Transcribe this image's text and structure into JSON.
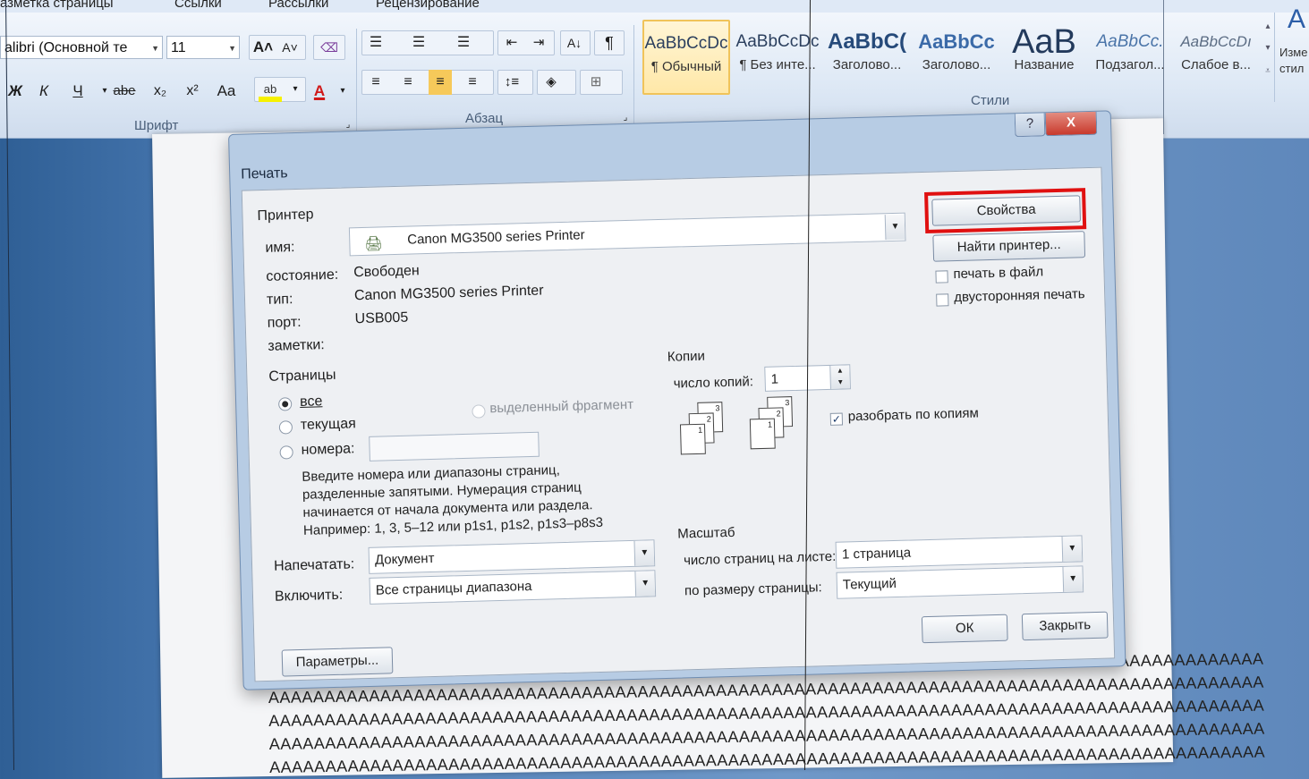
{
  "ribbon": {
    "tabs": [
      "азметка страницы",
      "Ссылки",
      "Рассылки",
      "Рецензирование"
    ],
    "font_name": "alibri (Основной те",
    "font_size": "11",
    "groups": {
      "font": "Шрифт",
      "paragraph": "Абзац",
      "styles": "Стили"
    },
    "styles": [
      {
        "sample": "AaBbCcDc",
        "name": "¶ Обычный"
      },
      {
        "sample": "AaBbCcDc",
        "name": "¶ Без инте..."
      },
      {
        "sample": "AaBbC(",
        "name": "Заголово..."
      },
      {
        "sample": "AaBbCc",
        "name": "Заголово..."
      },
      {
        "sample": "AaB",
        "name": "Название"
      },
      {
        "sample": "AaBbCc.",
        "name": "Подзагол..."
      },
      {
        "sample": "AaBbCcDı",
        "name": "Слабое в..."
      }
    ],
    "change_styles": "Изме стил",
    "format_buttons": {
      "bold": "Ж",
      "italic": "К",
      "underline": "Ч",
      "strike": "abe",
      "sub": "x₂",
      "sup": "x²",
      "case": "Aa",
      "grow": "A˄",
      "shrink": "A˅"
    }
  },
  "dialog": {
    "title": "Печать",
    "help_button": "?",
    "close_button": "X",
    "printer_section": "Принтер",
    "name_label": "имя:",
    "printer_name": "Canon MG3500 series Printer",
    "status_label": "состояние:",
    "status_value": "Свободен",
    "type_label": "тип:",
    "type_value": "Canon MG3500 series Printer",
    "port_label": "порт:",
    "port_value": "USB005",
    "notes_label": "заметки:",
    "properties_button": "Свойства",
    "find_printer_button": "Найти принтер...",
    "print_to_file": "печать в файл",
    "duplex": "двусторонняя печать",
    "pages_section": "Страницы",
    "radio_all": "все",
    "radio_current": "текущая",
    "radio_selection": "выделенный фрагмент",
    "radio_numbers": "номера:",
    "hint_lines": [
      "Введите номера или диапазоны страниц,",
      "разделенные запятыми. Нумерация страниц",
      "начинается от начала документа или раздела.",
      "Например: 1, 3, 5–12 или p1s1, p1s2, p1s3–p8s3"
    ],
    "copies_section": "Копии",
    "copies_label": "число копий:",
    "copies_value": "1",
    "collate": "разобрать по копиям",
    "print_what_label": "Напечатать:",
    "print_what_value": "Документ",
    "include_label": "Включить:",
    "include_value": "Все страницы диапазона",
    "zoom_section": "Масштаб",
    "pages_per_sheet_label": "число страниц на листе:",
    "pages_per_sheet_value": "1 страница",
    "scale_label": "по размеру страницы:",
    "scale_value": "Текущий",
    "ok_button": "ОК",
    "close_btn": "Закрыть",
    "params_button": "Параметры...",
    "collate_stack_numbers": [
      "1",
      "2",
      "3"
    ]
  },
  "document": {
    "line_text": "AAAAAAAAAAAAAAAAAAAAAAAAAAAAAAAAAAAAAAAAAAAAAAAAAAAAAAAAAAAAAAAAAAAAAAAAAAAAAAAAAAAAAAAAA",
    "side_letter": "A"
  },
  "colors": {
    "highlight": "#e01010",
    "dialog_frame": "#b7cce4",
    "close_red": "#c8392c"
  }
}
